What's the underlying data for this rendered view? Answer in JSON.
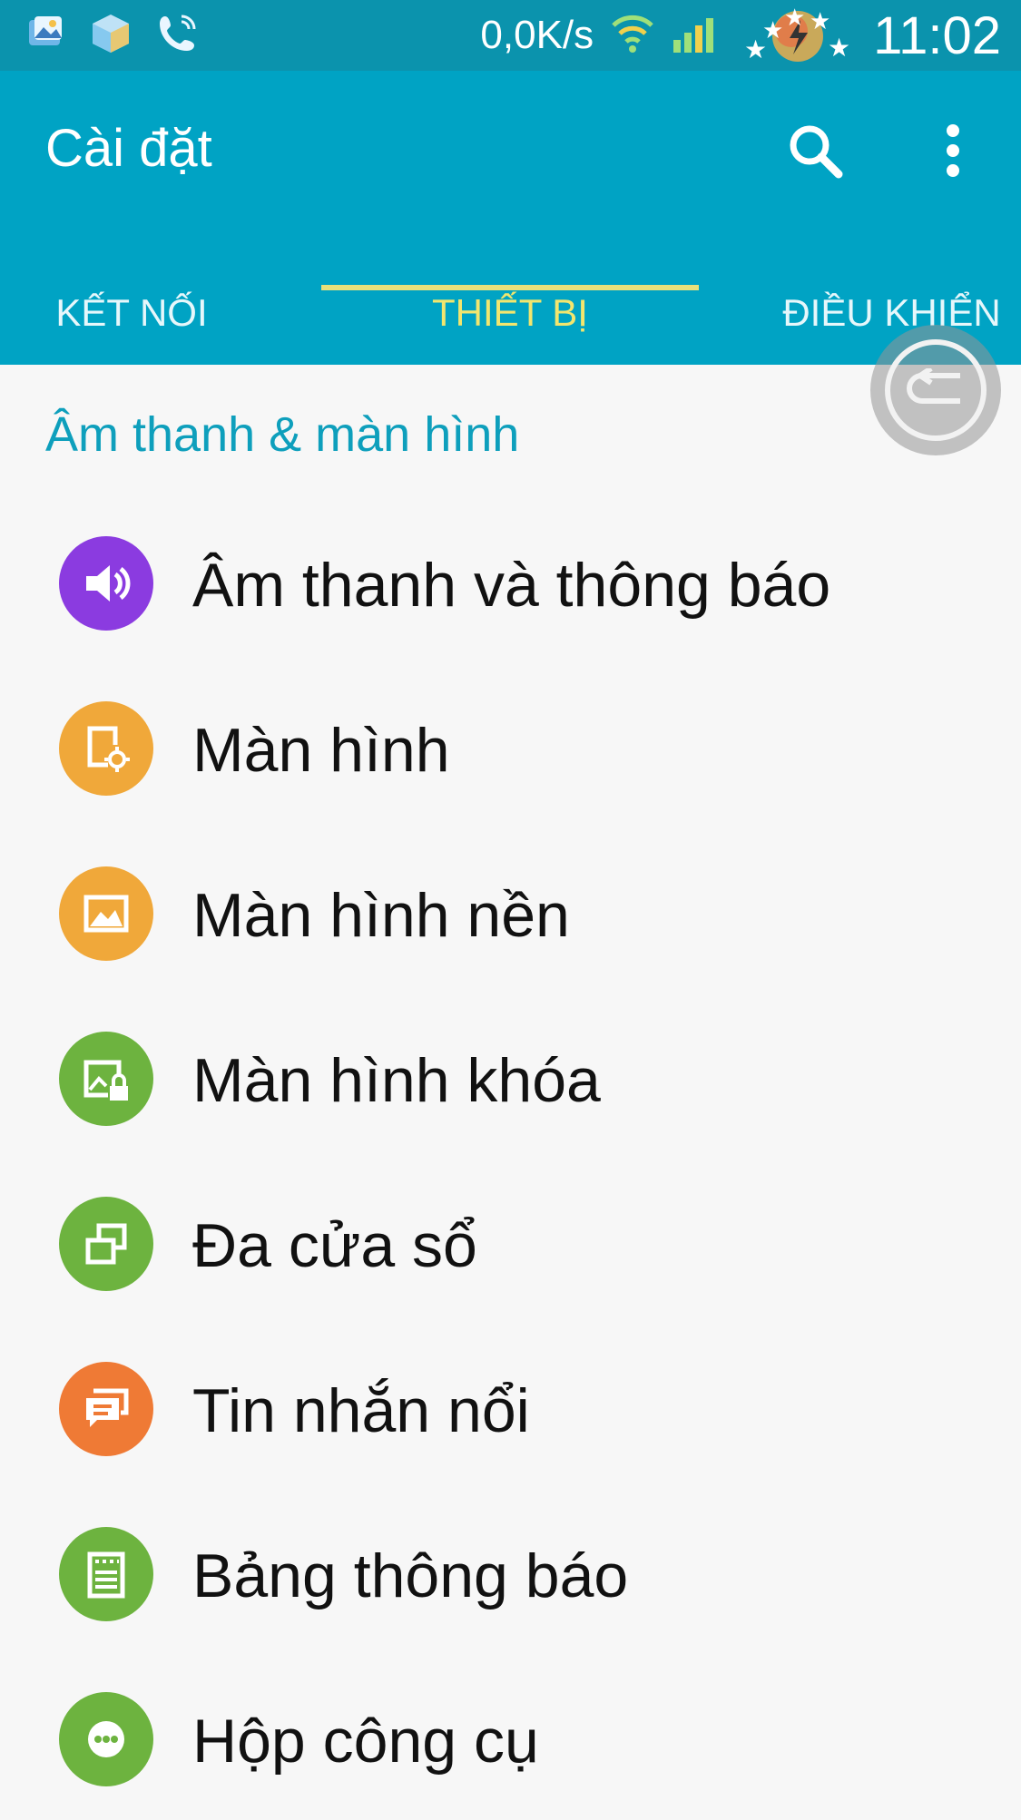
{
  "status_bar": {
    "speed": "0,0K/s",
    "time": "11:02",
    "icons": [
      "gallery-icon",
      "box-icon",
      "phone-call-icon",
      "wifi-icon",
      "signal-icon",
      "battery-charging-icon"
    ]
  },
  "app_bar": {
    "title": "Cài đặt",
    "search_icon": "search-icon",
    "more_icon": "more-vert-icon",
    "color": "#00a3c4"
  },
  "tabs": [
    {
      "label": "KẾT NỐI",
      "active": false
    },
    {
      "label": "THIẾT BỊ",
      "active": true
    },
    {
      "label": "ĐIỀU KHIỂN",
      "active": false
    }
  ],
  "section": {
    "title": "Âm thanh & màn hình"
  },
  "items": [
    {
      "label": "Âm thanh và thông báo",
      "icon": "volume-icon",
      "color": "#8b3be0"
    },
    {
      "label": "Màn hình",
      "icon": "display-settings-icon",
      "color": "#f0a83a"
    },
    {
      "label": "Màn hình nền",
      "icon": "wallpaper-icon",
      "color": "#f0a83a"
    },
    {
      "label": "Màn hình khóa",
      "icon": "lock-screen-icon",
      "color": "#6db33f"
    },
    {
      "label": "Đa cửa sổ",
      "icon": "multi-window-icon",
      "color": "#6db33f"
    },
    {
      "label": "Tin nhắn nổi",
      "icon": "floating-message-icon",
      "color": "#ef7a35"
    },
    {
      "label": "Bảng thông báo",
      "icon": "notification-panel-icon",
      "color": "#6db33f"
    },
    {
      "label": "Hộp công cụ",
      "icon": "toolbox-icon",
      "color": "#6db33f"
    }
  ]
}
